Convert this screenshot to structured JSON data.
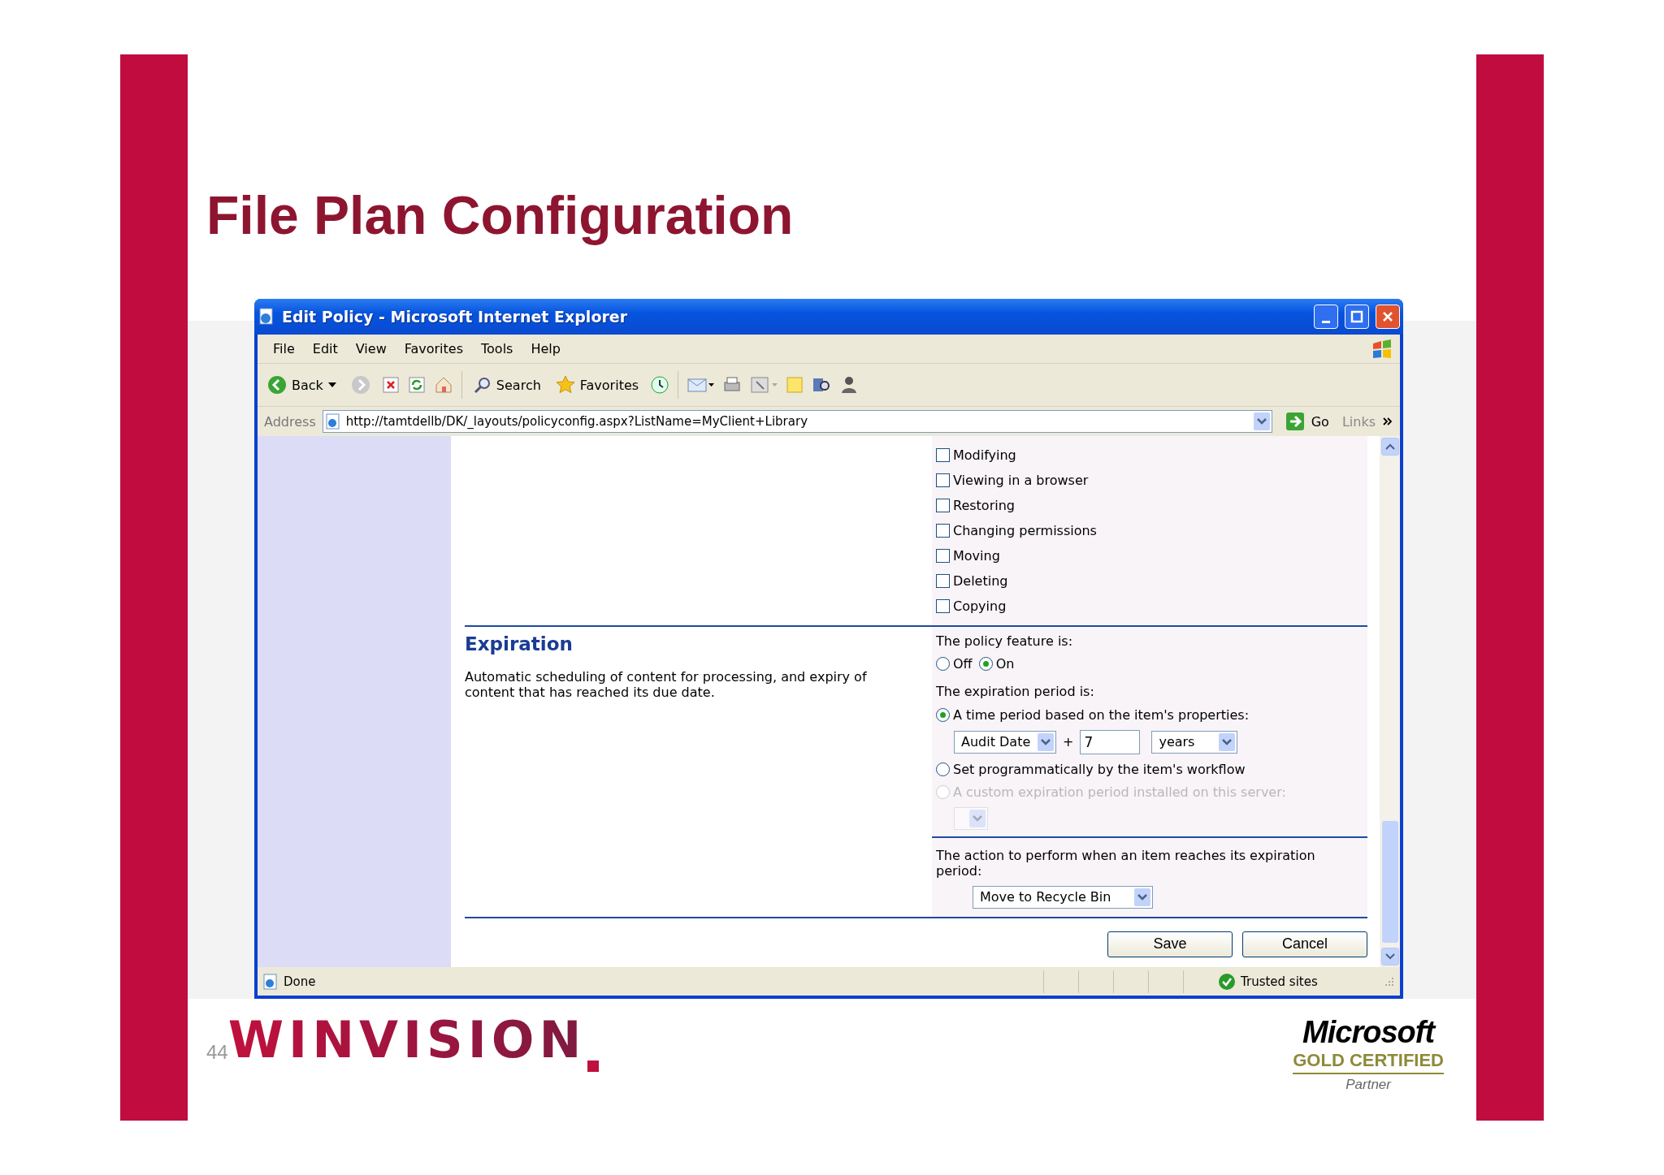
{
  "slide": {
    "title": "File Plan Configuration",
    "page_number": "44"
  },
  "window": {
    "title": "Edit Policy - Microsoft Internet Explorer"
  },
  "menu": [
    "File",
    "Edit",
    "View",
    "Favorites",
    "Tools",
    "Help"
  ],
  "toolbar": {
    "back": "Back",
    "search": "Search",
    "favorites": "Favorites"
  },
  "address": {
    "label": "Address",
    "url": "http://tamtdellb/DK/_layouts/policyconfig.aspx?ListName=MyClient+Library",
    "go": "Go",
    "links": "Links"
  },
  "checkboxes": [
    {
      "label": "Modifying",
      "checked": false
    },
    {
      "label": "Viewing in a browser",
      "checked": false
    },
    {
      "label": "Restoring",
      "checked": false
    },
    {
      "label": "Changing permissions",
      "checked": false
    },
    {
      "label": "Moving",
      "checked": false
    },
    {
      "label": "Deleting",
      "checked": false
    },
    {
      "label": "Copying",
      "checked": false
    }
  ],
  "expiration": {
    "heading": "Expiration",
    "description": "Automatic scheduling of content for processing, and expiry of content that has reached its due date.",
    "feature_label": "The policy feature is:",
    "feature_options": [
      {
        "label": "Off",
        "selected": false
      },
      {
        "label": "On",
        "selected": true
      }
    ],
    "period_label": "The expiration period is:",
    "period_options": [
      {
        "kind": "properties",
        "label": "A time period based on the item's properties:",
        "selected": true,
        "disabled": false
      },
      {
        "kind": "workflow",
        "label": "Set programmatically by the item's workflow",
        "selected": false,
        "disabled": false
      },
      {
        "kind": "custom",
        "label": "A custom expiration period installed on this server:",
        "selected": false,
        "disabled": true
      }
    ],
    "date_field": "Audit Date",
    "plus": "+",
    "amount": "7",
    "unit": "years",
    "action_label": "The action to perform when an item reaches its expiration period:",
    "action": "Move to Recycle Bin"
  },
  "buttons": [
    "Save",
    "Cancel"
  ],
  "status": {
    "text": "Done",
    "zone": "Trusted sites"
  },
  "logos": {
    "company": "WINVISION",
    "partner_brand": "Microsoft",
    "partner_level": "GOLD CERTIFIED",
    "partner_word": "Partner"
  }
}
